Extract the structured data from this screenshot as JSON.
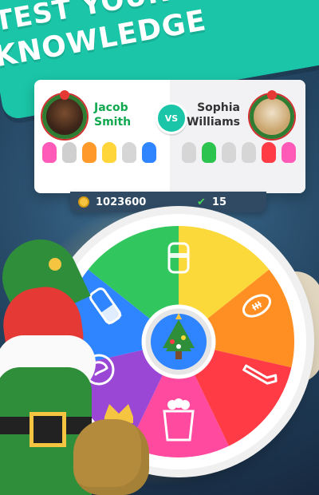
{
  "header": {
    "title_line1": "TEST YOUR",
    "title_line2": "KNOWLEDGE"
  },
  "match": {
    "player_left_name": "Jacob Smith",
    "player_right_name": "Sophia Williams",
    "vs_label": "VS"
  },
  "stats": {
    "coins": "1023600",
    "wins": "15"
  },
  "wheel": {
    "segments": [
      {
        "name": "history",
        "color": "#fbd93b"
      },
      {
        "name": "sports",
        "color": "#ff8f22"
      },
      {
        "name": "art",
        "color": "#ff3b46"
      },
      {
        "name": "entertainment",
        "color": "#ff4a9f"
      },
      {
        "name": "crown",
        "color": "#9a47d6"
      },
      {
        "name": "geography",
        "color": "#2f84ff"
      },
      {
        "name": "science",
        "color": "#32c65f"
      }
    ],
    "center_icon": "christmas-tree-icon"
  },
  "colors": {
    "teal": "#1bc6a8",
    "card_bg": "#ffffff",
    "green_text": "#10a84f"
  }
}
